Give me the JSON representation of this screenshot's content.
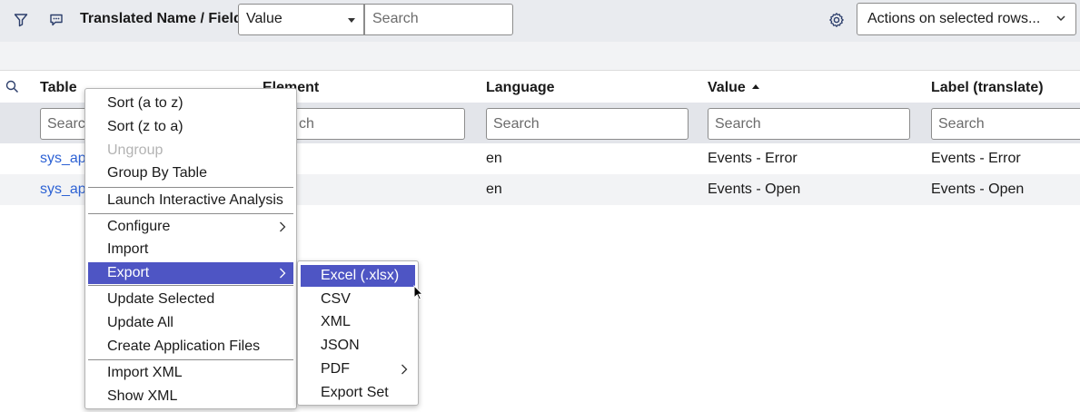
{
  "toolbar": {
    "filter_icon": "filter-icon",
    "comment_icon": "comment-icon",
    "title": "Translated Name / Fields",
    "field_select": "Value",
    "search_placeholder": "Search",
    "settings_icon": "gear-icon",
    "actions": "Actions on selected rows..."
  },
  "columns": [
    "Table",
    "Element",
    "Language",
    "Value",
    "Label (translate)"
  ],
  "filter_placeholders": [
    "Search",
    "ch",
    "Search",
    "Search",
    "Search"
  ],
  "rows": [
    {
      "table": "sys_app",
      "language": "en",
      "value": "Events - Error",
      "label": "Events - Error"
    },
    {
      "table": "sys_app",
      "language": "en",
      "value": "Events - Open",
      "label": "Events - Open"
    }
  ],
  "context_menu": {
    "items": [
      "Sort (a to z)",
      "Sort (z to a)",
      "Ungroup",
      "Group By Table",
      "Launch Interactive Analysis",
      "Configure",
      "Import",
      "Export",
      "Update Selected",
      "Update All",
      "Create Application Files",
      "Import XML",
      "Show XML"
    ]
  },
  "export_menu": {
    "items": [
      "Excel (.xlsx)",
      "CSV",
      "XML",
      "JSON",
      "PDF",
      "Export Set"
    ]
  },
  "colors": {
    "accent": "#4e55c4",
    "link": "#2d62d4",
    "toolbar_bg": "#e9ebef"
  }
}
